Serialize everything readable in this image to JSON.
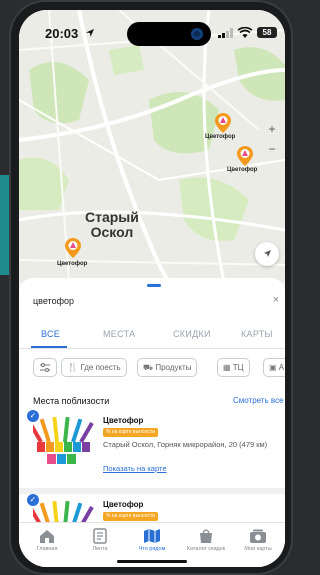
{
  "status": {
    "time": "20:03",
    "battery": "58"
  },
  "map": {
    "city_line1": "Старый",
    "city_line2": "Оскол",
    "pins": [
      {
        "label": "Цветофор"
      },
      {
        "label": "Цветофор"
      },
      {
        "label": "Цветофор"
      }
    ],
    "zoom_in": "+",
    "zoom_out": "−"
  },
  "search": {
    "value": "цветофор",
    "clear": "×"
  },
  "tabs": [
    {
      "label": "ВСЕ",
      "active": true
    },
    {
      "label": "МЕСТА",
      "active": false
    },
    {
      "label": "СКИДКИ",
      "active": false
    },
    {
      "label": "КАРТЫ",
      "active": false
    }
  ],
  "filters": [
    {
      "label": ""
    },
    {
      "label": "Где поесть"
    },
    {
      "label": "Продукты"
    },
    {
      "label": "ТЦ"
    },
    {
      "label": "А"
    }
  ],
  "nearby": {
    "title": "Места поблизости",
    "see_all": "Смотреть все",
    "cards": [
      {
        "name": "Цветофор",
        "badge": "% на карте выноости",
        "address": "Старый Оскол, Горняк микрорайон, 20 (479 км)",
        "show_on_map": "Показать на карте"
      },
      {
        "name": "Цветофор",
        "badge": "% на карте выноости"
      }
    ]
  },
  "tabbar": [
    {
      "label": "Главная",
      "icon": "home-icon"
    },
    {
      "label": "Лента",
      "icon": "feed-icon"
    },
    {
      "label": "Что рядом",
      "icon": "map-icon",
      "active": true
    },
    {
      "label": "Каталог скидок",
      "icon": "bag-icon"
    },
    {
      "label": "Мои карты",
      "icon": "cards-icon"
    }
  ],
  "colors": {
    "accent": "#2a6fd6",
    "pin": "#f39a1e",
    "badge": "#f5a623"
  }
}
